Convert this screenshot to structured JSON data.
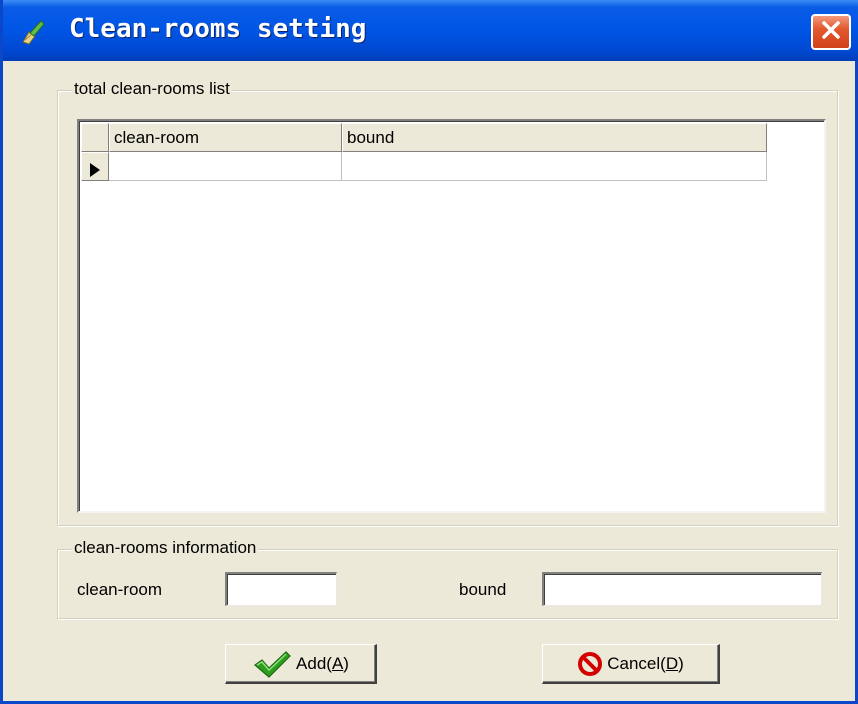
{
  "window": {
    "title": "Clean-rooms setting",
    "title_icon": "broom-icon",
    "close_icon": "close-x-icon"
  },
  "list_group": {
    "legend": "total clean-rooms list",
    "columns": [
      "clean-room",
      "bound"
    ],
    "rows": [
      {
        "current": true,
        "cells": [
          "",
          ""
        ]
      }
    ]
  },
  "info_group": {
    "legend": "clean-rooms information",
    "clean_room_label": "clean-room",
    "clean_room_value": "",
    "bound_label": "bound",
    "bound_value": ""
  },
  "buttons": {
    "add": {
      "prefix": "Add(",
      "hotkey": "A",
      "suffix": ")",
      "icon": "checkmark-icon"
    },
    "cancel": {
      "prefix": "Cancel(",
      "hotkey": "D",
      "suffix": ")",
      "icon": "prohibit-icon"
    }
  },
  "colors": {
    "titlebar": "#0055e5",
    "close": "#e35a2f",
    "face": "#ece9d8",
    "check_green": "#2e9e1e",
    "cancel_red": "#d40000"
  }
}
